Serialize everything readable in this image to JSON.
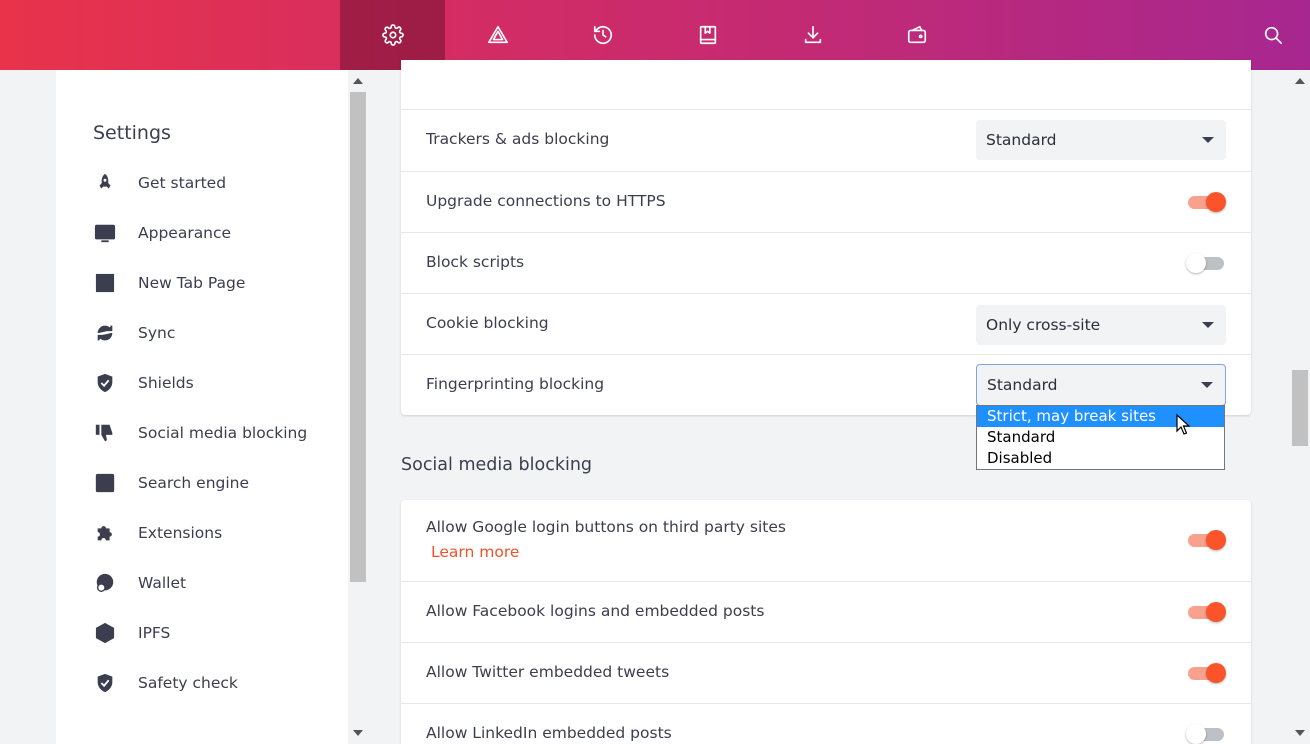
{
  "colors": {
    "accent": "#fb542b",
    "link": "#f0522c",
    "selected_option": "#1e90ff",
    "topbar_start": "#e8334a",
    "topbar_end": "#a72790"
  },
  "topbar": {
    "buttons": [
      {
        "icon": "gear-icon",
        "active": true
      },
      {
        "icon": "brave-rewards-triangle-icon"
      },
      {
        "icon": "history-icon"
      },
      {
        "icon": "bookmarks-icon"
      },
      {
        "icon": "download-icon"
      },
      {
        "icon": "wallet-icon"
      }
    ],
    "search_icon": "search-icon"
  },
  "sidebar": {
    "title": "Settings",
    "items": [
      {
        "label": "Get started",
        "icon": "rocket-icon"
      },
      {
        "label": "Appearance",
        "icon": "appearance-icon"
      },
      {
        "label": "New Tab Page",
        "icon": "new-tab-icon"
      },
      {
        "label": "Sync",
        "icon": "sync-icon"
      },
      {
        "label": "Shields",
        "icon": "shield-check-icon"
      },
      {
        "label": "Social media blocking",
        "icon": "thumbs-down-icon"
      },
      {
        "label": "Search engine",
        "icon": "search-engine-icon"
      },
      {
        "label": "Extensions",
        "icon": "puzzle-icon"
      },
      {
        "label": "Wallet",
        "icon": "wallet-circle-icon"
      },
      {
        "label": "IPFS",
        "icon": "cube-icon"
      },
      {
        "label": "Safety check",
        "icon": "shield-check-icon"
      }
    ]
  },
  "shields": {
    "rows": [
      {
        "label": "Trackers & ads blocking",
        "type": "select",
        "value": "Standard"
      },
      {
        "label": "Upgrade connections to HTTPS",
        "type": "toggle",
        "on": true
      },
      {
        "label": "Block scripts",
        "type": "toggle",
        "on": false
      },
      {
        "label": "Cookie blocking",
        "type": "select",
        "value": "Only cross-site"
      },
      {
        "label": "Fingerprinting blocking",
        "type": "select",
        "value": "Standard",
        "open": true
      }
    ]
  },
  "fingerprinting_dropdown": {
    "options": [
      "Strict, may break sites",
      "Standard",
      "Disabled"
    ],
    "highlighted": 0
  },
  "social": {
    "title": "Social media blocking",
    "rows": [
      {
        "label": "Allow Google login buttons on third party sites",
        "link": "Learn more",
        "on": true
      },
      {
        "label": "Allow Facebook logins and embedded posts",
        "on": true
      },
      {
        "label": "Allow Twitter embedded tweets",
        "on": true
      },
      {
        "label": "Allow LinkedIn embedded posts",
        "on": false
      }
    ]
  }
}
